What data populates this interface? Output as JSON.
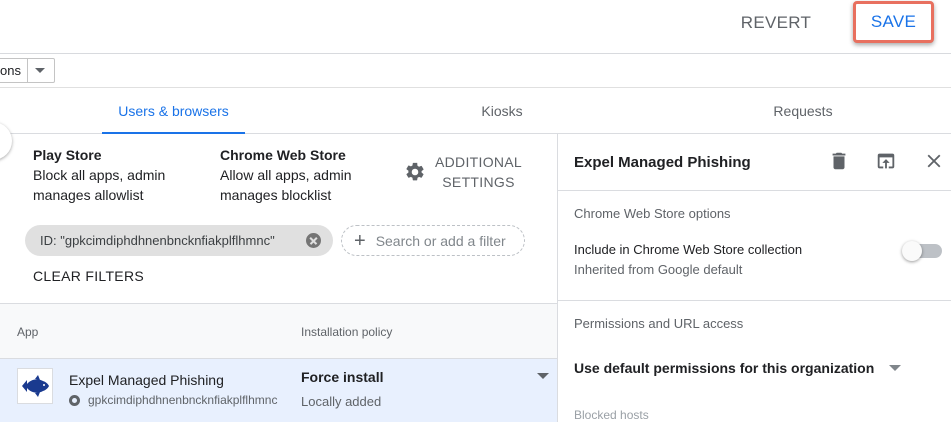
{
  "header": {
    "revert_label": "REVERT",
    "save_label": "SAVE"
  },
  "org_unit": {
    "value_fragment": "ons"
  },
  "tabs": [
    {
      "label": "Users & browsers",
      "active": true
    },
    {
      "label": "Kiosks",
      "active": false
    },
    {
      "label": "Requests",
      "active": false
    }
  ],
  "store_settings": {
    "play_store": {
      "title": "Play Store",
      "line1": "Block all apps, admin",
      "line2": "manages allowlist"
    },
    "chrome_web_store": {
      "title": "Chrome Web Store",
      "line1": "Allow all apps, admin",
      "line2": "manages blocklist"
    },
    "additional_settings": {
      "line1": "ADDITIONAL",
      "line2": "SETTINGS",
      "icon": "gear-icon"
    }
  },
  "filters": {
    "chip_label": "ID: \"gpkcimdiphdhnenbncknfiakplflhmnc\"",
    "search_placeholder": "Search or add a filter",
    "clear_label": "CLEAR FILTERS"
  },
  "table": {
    "columns": [
      "App",
      "Installation policy"
    ],
    "rows": [
      {
        "name": "Expel Managed Phishing",
        "id": "gpkcimdiphdhnenbncknfiakplflhmnc",
        "policy": "Force install",
        "policy_note": "Locally added"
      }
    ]
  },
  "detail_panel": {
    "title": "Expel Managed Phishing",
    "icons": [
      "trash-icon",
      "open-in-new-icon",
      "close-icon"
    ],
    "cws_section": "Chrome Web Store options",
    "include_label": "Include in Chrome Web Store collection",
    "include_sub": "Inherited from Google default",
    "include_enabled": false,
    "permissions_section": "Permissions and URL access",
    "permissions_value": "Use default permissions for this organization",
    "blocked_hosts_label": "Blocked hosts"
  },
  "colors": {
    "accent": "#1a73e8",
    "highlight_border": "#e8705f",
    "selected_row": "#e8f0fe",
    "app_icon_blue": "#1a3a8f"
  }
}
